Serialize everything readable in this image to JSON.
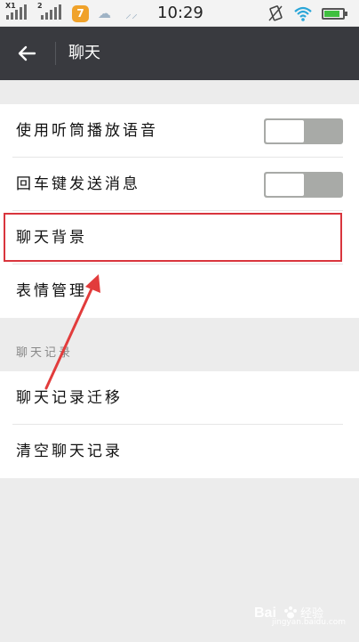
{
  "status_bar": {
    "sim1_label": "X1",
    "sim2_label": "2",
    "notification_badge": "7",
    "time": "10:29",
    "battery_level": 0.85
  },
  "titlebar": {
    "title": "聊天"
  },
  "settings": {
    "rows": [
      {
        "label": "使用听筒播放语音",
        "toggle": "off"
      },
      {
        "label": "回车键发送消息",
        "toggle": "off"
      },
      {
        "label": "聊天背景"
      },
      {
        "label": "表情管理"
      }
    ]
  },
  "history": {
    "header": "聊天记录",
    "rows": [
      {
        "label": "聊天记录迁移"
      },
      {
        "label": "清空聊天记录"
      }
    ]
  },
  "watermark": {
    "text": "Bai",
    "text2": "经验",
    "sub": "jingyan.baidu.com"
  },
  "colors": {
    "titlebar": "#393a3f",
    "highlight": "#d9353d",
    "background": "#ececec"
  }
}
